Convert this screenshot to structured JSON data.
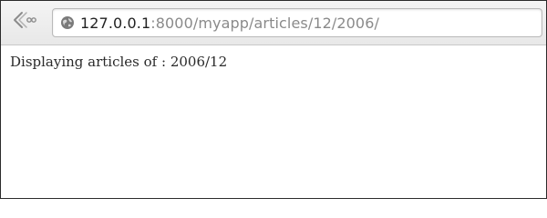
{
  "toolbar": {
    "back_icon": "back-arrow-icon",
    "address_icon": "globe-icon",
    "url_host": "127.0.0.1",
    "url_rest": ":8000/myapp/articles/12/2006/"
  },
  "page": {
    "message": "Displaying articles of : 2006/12"
  },
  "colors": {
    "toolbar_bg": "#ececec",
    "url_host": "#222222",
    "url_rest": "#8a8a8a",
    "text": "#2a2a2a",
    "icon": "#7a7a7a"
  }
}
